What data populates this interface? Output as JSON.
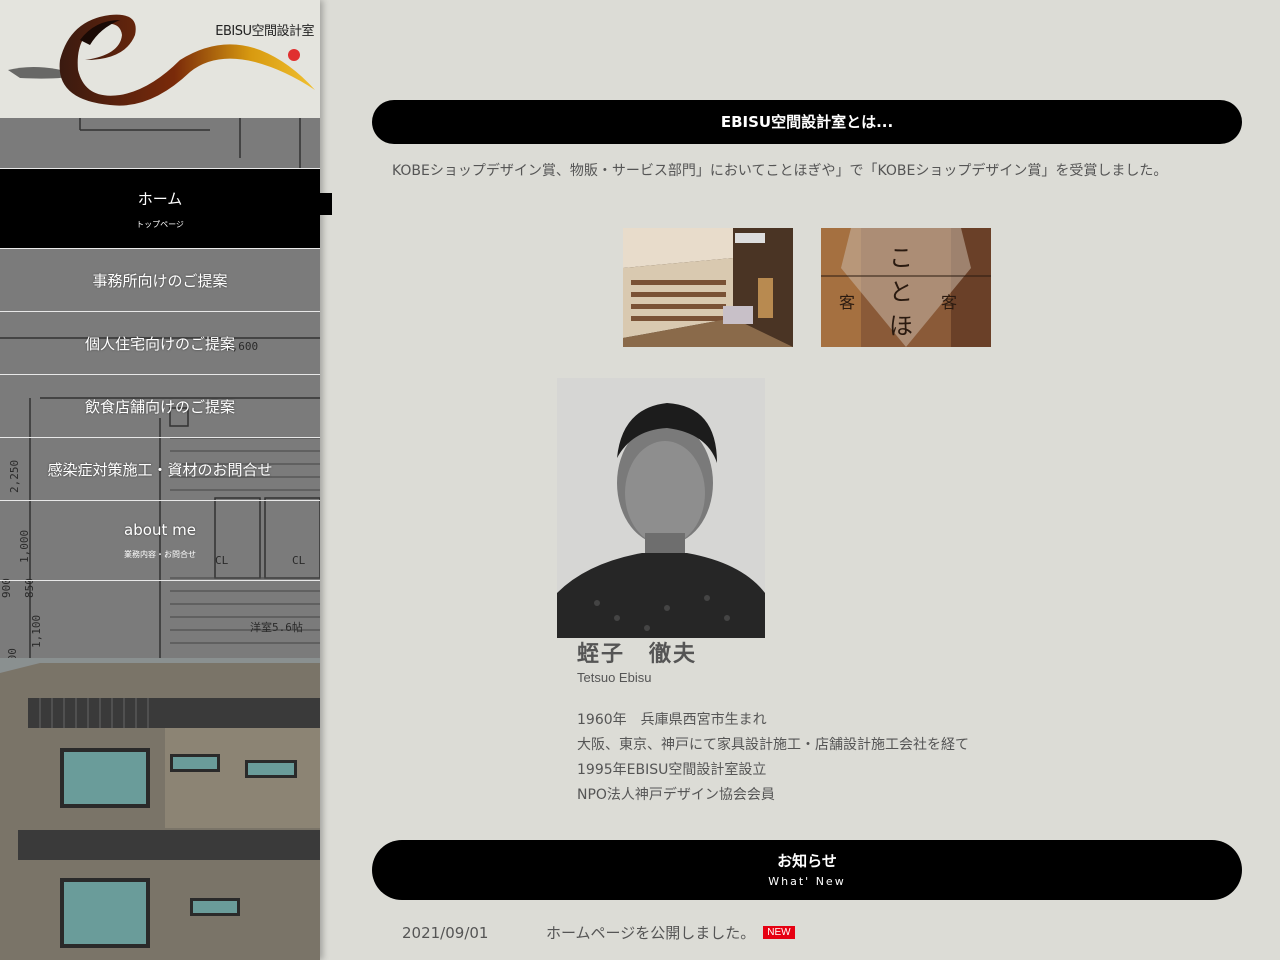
{
  "site": {
    "logo_text": "EBISU空間設計室"
  },
  "nav": {
    "items": [
      {
        "label": "ホーム",
        "sub": "トップページ"
      },
      {
        "label": "事務所向けのご提案",
        "sub": ""
      },
      {
        "label": "個人住宅向けのご提案",
        "sub": ""
      },
      {
        "label": "飲食店舗向けのご提案",
        "sub": ""
      },
      {
        "label": "感染症対策施工・資材のお問合せ",
        "sub": ""
      },
      {
        "label": "about me",
        "sub": "業務内容・お問合せ"
      }
    ]
  },
  "about": {
    "heading": "EBISU空間設計室とは...",
    "intro": "KOBEショップデザイン賞、物販・サービス部門」においてことほぎや」で「KOBEショップデザイン賞」を受賞しました。"
  },
  "profile": {
    "name": "蛭子　徹夫",
    "name_en": "Tetsuo Ebisu",
    "bio": [
      "1960年　兵庫県西宮市生まれ",
      "大阪、東京、神戸にて家具設計施工・店舗設計施工会社を経て",
      "1995年EBISU空間設計室設立",
      "NPO法人神戸デザイン協会会員"
    ]
  },
  "news": {
    "heading": "お知らせ",
    "heading_en": "What' New",
    "items": [
      {
        "date": "2021/09/01",
        "text": "ホームページを公開しました。",
        "badge": "NEW"
      }
    ]
  },
  "colors": {
    "background": "#dcdcd6",
    "pill": "#000000",
    "badge": "#e60012",
    "sidebar": "#7d7d7d"
  }
}
